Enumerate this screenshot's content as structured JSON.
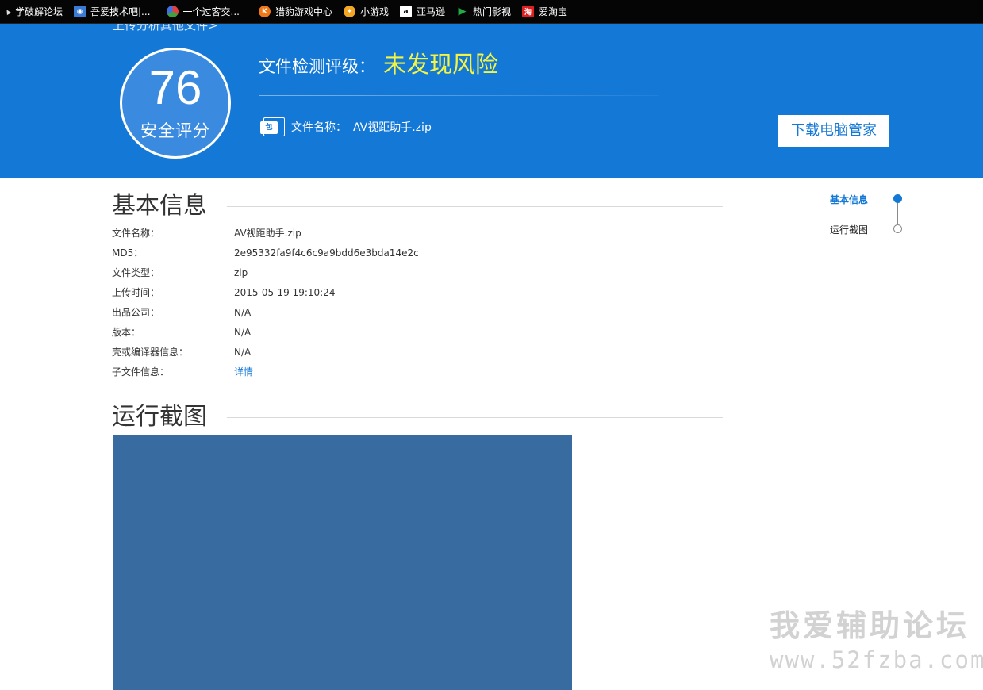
{
  "bookmarks": [
    {
      "label": "学破解论坛",
      "icon": "arrow-icon",
      "color": ""
    },
    {
      "label": "吾爱技术吧|...",
      "icon": "globe-icon",
      "color": "#3a7bd5"
    },
    {
      "label": "一个过客交...",
      "icon": "colorful-icon",
      "color": "#e0a030"
    },
    {
      "label": "猎豹游戏中心",
      "icon": "cheetah-icon",
      "color": "#f07818"
    },
    {
      "label": "小游戏",
      "icon": "game-icon",
      "color": "#f5a623"
    },
    {
      "label": "亚马逊",
      "icon": "amazon-icon",
      "color": "#ffffff"
    },
    {
      "label": "热门影视",
      "icon": "play-icon",
      "color": "#22aa44"
    },
    {
      "label": "爱淘宝",
      "icon": "taobao-icon",
      "color": "#e02020"
    }
  ],
  "hero": {
    "top_link": "上传分析其他文件>",
    "score": "76",
    "score_label": "安全评分",
    "rating_label": "文件检测评级：",
    "rating_value": "未发现风险",
    "file_label": "文件名称：",
    "file_name": "AV视距助手.zip",
    "file_icon_text": "包",
    "download_button": "下载电脑管家",
    "colors": {
      "background": "#1478d6",
      "rating_value": "#f4f542"
    }
  },
  "basic_info": {
    "title": "基本信息",
    "rows": [
      {
        "label": "文件名称：",
        "value": "AV视距助手.zip"
      },
      {
        "label": "MD5：",
        "value": "2e95332fa9f4c6c9a9bdd6e3bda14e2c"
      },
      {
        "label": "文件类型：",
        "value": "zip"
      },
      {
        "label": "上传时间：",
        "value": "2015-05-19 19:10:24"
      },
      {
        "label": "出品公司：",
        "value": "N/A"
      },
      {
        "label": "版本：",
        "value": "N/A"
      },
      {
        "label": "壳或编译器信息：",
        "value": "N/A"
      },
      {
        "label": "子文件信息：",
        "value": "详情"
      }
    ]
  },
  "screenshot_section": {
    "title": "运行截图"
  },
  "right_nav": {
    "items": [
      "基本信息",
      "运行截图"
    ]
  },
  "watermark": {
    "text": "我爱辅助论坛",
    "url": "www.52fzba.com"
  }
}
